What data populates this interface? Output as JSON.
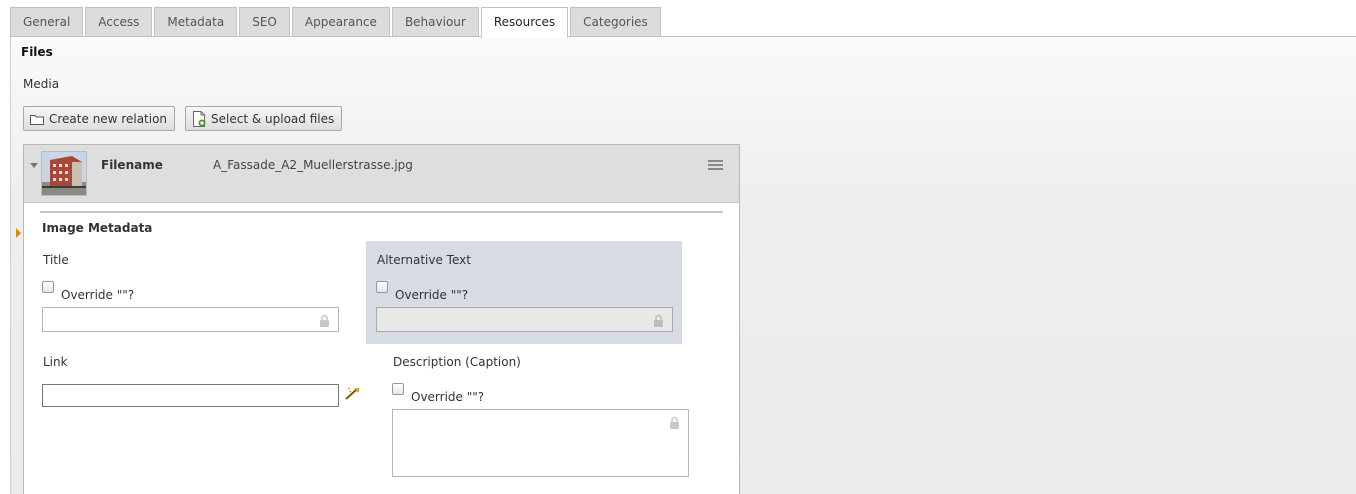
{
  "tabs": [
    {
      "label": "General",
      "active": false
    },
    {
      "label": "Access",
      "active": false
    },
    {
      "label": "Metadata",
      "active": false
    },
    {
      "label": "SEO",
      "active": false
    },
    {
      "label": "Appearance",
      "active": false
    },
    {
      "label": "Behaviour",
      "active": false
    },
    {
      "label": "Resources",
      "active": true
    },
    {
      "label": "Categories",
      "active": false
    }
  ],
  "files": {
    "section_title": "Files",
    "media_label": "Media",
    "create_button": "Create new relation",
    "upload_button": "Select & upload files",
    "record": {
      "header_label": "Filename",
      "filename": "A_Fassade_A2_Muellerstrasse.jpg",
      "metadata_title": "Image Metadata",
      "title_label": "Title",
      "title_override": "Override \"\"?",
      "title_value": "",
      "alt_label": "Alternative Text",
      "alt_override": "Override \"\"?",
      "alt_value": "",
      "link_label": "Link",
      "link_value": "",
      "description_label": "Description (Caption)",
      "description_override": "Override \"\"?",
      "description_value": ""
    }
  },
  "colors": {
    "active_tab_bg": "#ffffff",
    "inactive_tab_bg": "#dcdcdc",
    "alt_highlight": "#d7dce4",
    "marker": "#e08a00"
  }
}
